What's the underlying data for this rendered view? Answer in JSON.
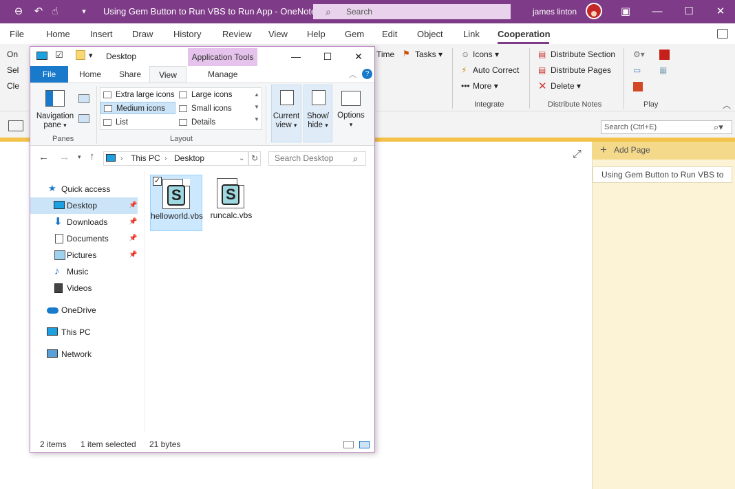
{
  "onenote": {
    "title": "Using Gem Button to Run VBS to Run App  -  OneNote",
    "search_placeholder": "Search",
    "user": "james linton",
    "menu": [
      "File",
      "Home",
      "Insert",
      "Draw",
      "History",
      "Review",
      "View",
      "Help",
      "Gem",
      "Edit",
      "Object",
      "Link",
      "Cooperation"
    ],
    "ribbon": {
      "hidden_left": [
        "On",
        "Sel",
        "Cle"
      ],
      "time": "Time",
      "tasks": "Tasks",
      "icons": "Icons",
      "auto_correct": "Auto Correct",
      "more": "More",
      "integrate": "Integrate",
      "distribute_section": "Distribute Section",
      "distribute_pages": "Distribute Pages",
      "delete": "Delete",
      "distribute_notes": "Distribute Notes",
      "play": "Play"
    },
    "search_page_placeholder": "Search (Ctrl+E)",
    "add_page": "Add Page",
    "page_title": "Using Gem Button to Run VBS to"
  },
  "explorer": {
    "title": "Desktop",
    "app_tools": "Application Tools",
    "tabs": {
      "file": "File",
      "home": "Home",
      "share": "Share",
      "view": "View",
      "manage": "Manage"
    },
    "ribbon": {
      "navigation_pane": "Navigation pane",
      "panes": "Panes",
      "layout_items": [
        "Extra large icons",
        "Large icons",
        "Medium icons",
        "Small icons",
        "List",
        "Details"
      ],
      "layout": "Layout",
      "current_view": "Current view",
      "show_hide": "Show/ hide",
      "options": "Options"
    },
    "address": [
      "This PC",
      "Desktop"
    ],
    "search_placeholder": "Search Desktop",
    "nav": [
      "Quick access",
      "Desktop",
      "Downloads",
      "Documents",
      "Pictures",
      "Music",
      "Videos",
      "OneDrive",
      "This PC",
      "Network"
    ],
    "files": [
      "helloworld.vbs",
      "runcalc.vbs"
    ],
    "status": {
      "items": "2 items",
      "selected": "1 item selected",
      "size": "21 bytes"
    }
  }
}
